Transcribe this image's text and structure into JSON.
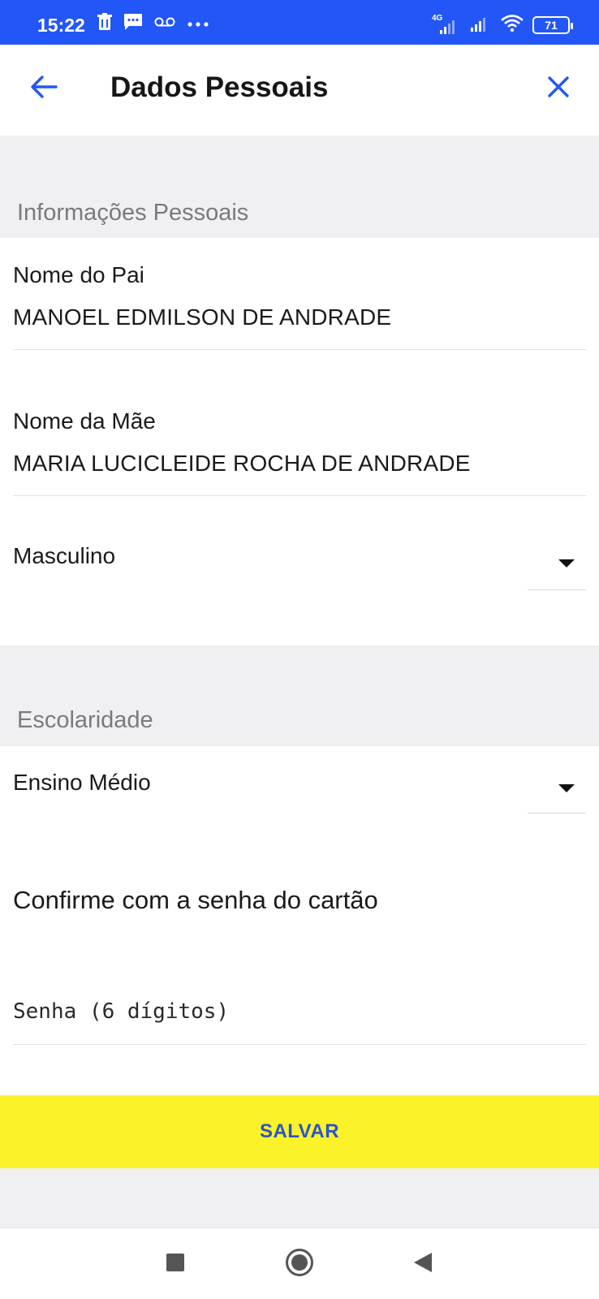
{
  "status_bar": {
    "time": "15:22",
    "network_label": "4G",
    "battery": "71",
    "left_icons": [
      "trash-icon",
      "message-icon",
      "voicemail-icon",
      "more-dots-icon"
    ],
    "right_icons": [
      "signal-4g-icon",
      "signal-icon",
      "wifi-icon",
      "battery-icon"
    ]
  },
  "app_bar": {
    "title": "Dados Pessoais",
    "back_icon": "arrow-left-icon",
    "close_icon": "close-icon",
    "accent_color": "#2356f6"
  },
  "personal_info": {
    "section_title": "Informações Pessoais",
    "father": {
      "label": "Nome do Pai",
      "value": "MANOEL EDMILSON DE ANDRADE"
    },
    "mother": {
      "label": "Nome da Mãe",
      "value": "MARIA LUCICLEIDE ROCHA DE ANDRADE"
    },
    "gender": {
      "selected": "Masculino"
    }
  },
  "education": {
    "section_title": "Escolaridade",
    "level": {
      "selected": "Ensino Médio"
    }
  },
  "confirm": {
    "text": "Confirme com a senha do cartão",
    "password_placeholder": "Senha (6 dígitos)"
  },
  "save_button": {
    "label": "SALVAR",
    "background_color": "#fcf22a",
    "text_color": "#2a55c8"
  },
  "nav_bar": {
    "icons": [
      "recents-square-icon",
      "home-circle-icon",
      "back-triangle-icon"
    ]
  }
}
